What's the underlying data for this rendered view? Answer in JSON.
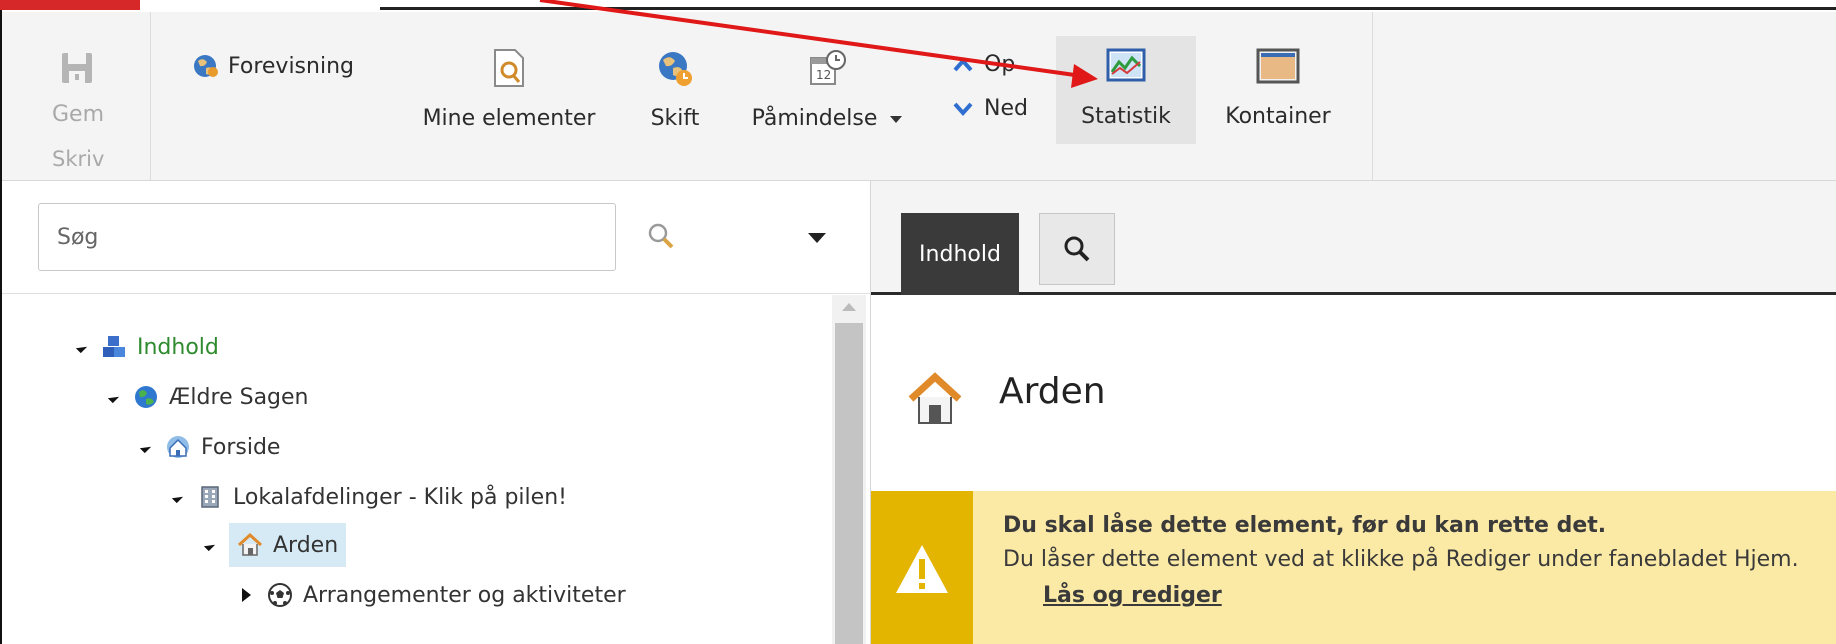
{
  "ribbon": {
    "save_label": "Gem",
    "write_group_label": "Skriv",
    "preview_label": "Forevisning",
    "my_items_label": "Mine elementer",
    "switch_label": "Skift",
    "reminder_label": "Påmindelse",
    "up_label": "Op",
    "down_label": "Ned",
    "statistics_label": "Statistik",
    "container_label": "Kontainer"
  },
  "search": {
    "placeholder": "Søg"
  },
  "tree": {
    "items": [
      {
        "label": "Indhold",
        "expanded": true
      },
      {
        "label": "Ældre Sagen",
        "expanded": true
      },
      {
        "label": "Forside",
        "expanded": true
      },
      {
        "label": "Lokalafdelinger - Klik på pilen!",
        "expanded": true
      },
      {
        "label": "Arden",
        "expanded": true,
        "selected": true
      },
      {
        "label": "Arrangementer og aktiviteter",
        "expanded": false
      }
    ]
  },
  "editor": {
    "tab_label": "Indhold",
    "item_title": "Arden",
    "warning": {
      "title": "Du skal låse dette element, før du kan rette det.",
      "text": "Du låser dette element ved at klikke på Rediger under fanebladet Hjem.",
      "link": "Lås og rediger"
    }
  },
  "colors": {
    "accent_red": "#d62828",
    "warning_bg": "#fbe9a6",
    "warning_side": "#e3b400",
    "tree_green": "#2e8b2e",
    "selection": "#d6eaf6"
  }
}
